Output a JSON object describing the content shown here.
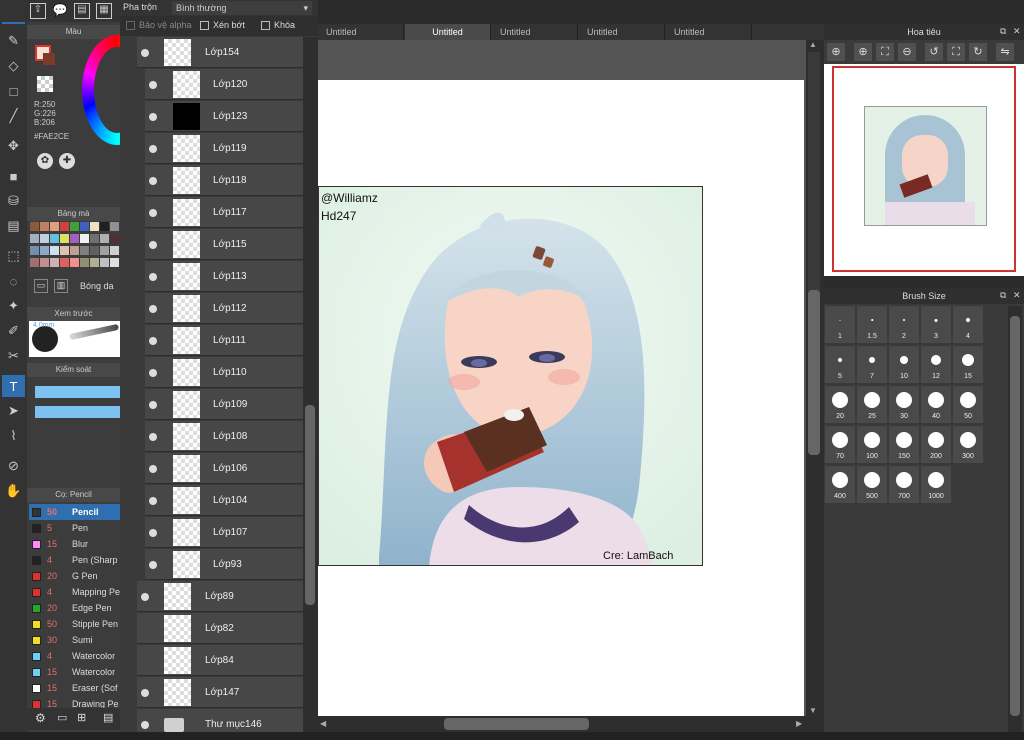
{
  "topbar": {
    "blend_label": "Pha trộn",
    "blend_value": "Bình thường",
    "protect_alpha": "Bảo vệ alpha",
    "clipping": "Xén bớt",
    "lock": "Khóa"
  },
  "tabs": [
    "Untitled",
    "Untitled",
    "Untitled",
    "Untitled",
    "Untitled"
  ],
  "color": {
    "header": "Màu",
    "r": "R:250",
    "g": "G:226",
    "b": "B:206",
    "hex": "#FAE2CE",
    "current": "#FAE2CE"
  },
  "palette_header": "Bảng mà",
  "shade_label": "Bóng da",
  "preview_header": "Xem trước",
  "preview_size": "4.0mm",
  "control_header": "Kiểm soát",
  "brush_header": "Cọ: Pencil",
  "brushes": [
    {
      "size": "50",
      "name": "Pencil",
      "color": "#333333"
    },
    {
      "size": "5",
      "name": "Pen",
      "color": "#222222"
    },
    {
      "size": "15",
      "name": "Blur",
      "color": "#ff88ff"
    },
    {
      "size": "4",
      "name": "Pen (Sharp",
      "color": "#222222"
    },
    {
      "size": "20",
      "name": "G Pen",
      "color": "#e03030"
    },
    {
      "size": "4",
      "name": "Mapping Pe",
      "color": "#e03030"
    },
    {
      "size": "20",
      "name": "Edge Pen",
      "color": "#22aa22"
    },
    {
      "size": "50",
      "name": "Stipple Pen",
      "color": "#f0e020"
    },
    {
      "size": "30",
      "name": "Sumi",
      "color": "#f0e020"
    },
    {
      "size": "4",
      "name": "Watercolor",
      "color": "#70d0f0"
    },
    {
      "size": "15",
      "name": "Watercolor",
      "color": "#70d0f0"
    },
    {
      "size": "15",
      "name": "Eraser (Sof",
      "color": "#ffffff"
    },
    {
      "size": "15",
      "name": "Drawing Pe",
      "color": "#e03030"
    }
  ],
  "layers": [
    {
      "name": "Lớp154",
      "indent": 0,
      "visible": true
    },
    {
      "name": "Lớp120",
      "indent": 1,
      "visible": true
    },
    {
      "name": "Lớp123",
      "indent": 1,
      "visible": true,
      "dark": true
    },
    {
      "name": "Lớp119",
      "indent": 1,
      "visible": true
    },
    {
      "name": "Lớp118",
      "indent": 1,
      "visible": true
    },
    {
      "name": "Lớp117",
      "indent": 1,
      "visible": true
    },
    {
      "name": "Lớp115",
      "indent": 1,
      "visible": true
    },
    {
      "name": "Lớp113",
      "indent": 1,
      "visible": true
    },
    {
      "name": "Lớp112",
      "indent": 1,
      "visible": true
    },
    {
      "name": "Lớp111",
      "indent": 1,
      "visible": true
    },
    {
      "name": "Lớp110",
      "indent": 1,
      "visible": true
    },
    {
      "name": "Lớp109",
      "indent": 1,
      "visible": true
    },
    {
      "name": "Lớp108",
      "indent": 1,
      "visible": true
    },
    {
      "name": "Lớp106",
      "indent": 1,
      "visible": true
    },
    {
      "name": "Lớp104",
      "indent": 1,
      "visible": true
    },
    {
      "name": "Lớp107",
      "indent": 1,
      "visible": true
    },
    {
      "name": "Lớp93",
      "indent": 1,
      "visible": true
    },
    {
      "name": "Lớp89",
      "indent": 0,
      "visible": true
    },
    {
      "name": "Lớp82",
      "indent": 0,
      "visible": false
    },
    {
      "name": "Lớp84",
      "indent": 0,
      "visible": false
    },
    {
      "name": "Lớp147",
      "indent": 0,
      "visible": true
    },
    {
      "name": "Thư mục146",
      "indent": 0,
      "visible": true,
      "folder": true
    }
  ],
  "navigator": {
    "title": "Hoa tiêu"
  },
  "brush_size": {
    "title": "Brush Size",
    "sizes": [
      "1",
      "1.5",
      "2",
      "3",
      "4",
      "5",
      "7",
      "10",
      "12",
      "15",
      "20",
      "25",
      "30",
      "40",
      "50",
      "70",
      "100",
      "150",
      "200",
      "300",
      "400",
      "500",
      "700",
      "1000"
    ]
  },
  "artwork": {
    "watermark_1": "@Williamz",
    "watermark_2": "Hd247",
    "credit": "Cre: LamBach"
  }
}
